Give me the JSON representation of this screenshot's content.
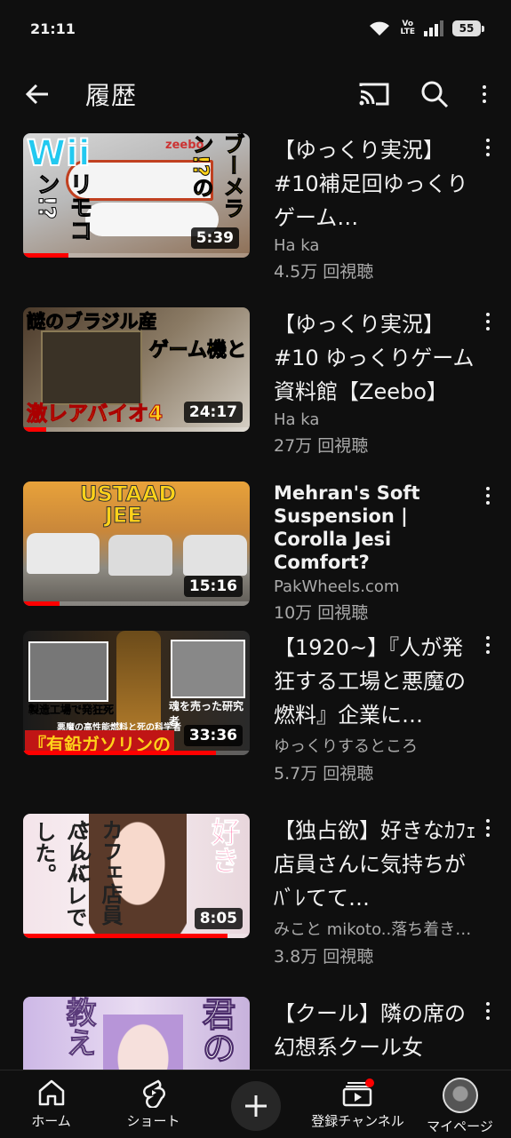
{
  "status": {
    "time": "21:11",
    "battery": "55",
    "volte_top": "Vo",
    "volte_bottom": "LTE"
  },
  "header": {
    "title": "履歴"
  },
  "videos": [
    {
      "title": "【ゆっくり実況】#10補足回ゆっくりゲーム…",
      "channel": "Ha ka",
      "views": "4.5万 回視聴",
      "duration": "5:39",
      "progress": 0.2,
      "thumb_texts": [
        "Wii",
        "リモコン!?",
        "ブーメラン!?の",
        "zeebo"
      ]
    },
    {
      "title": "【ゆっくり実況】#10 ゆっくりゲーム資料館【Zeebo】",
      "channel": "Ha ka",
      "views": "27万 回視聴",
      "duration": "24:17",
      "progress": 0.1,
      "thumb_texts": [
        "謎のブラジル産",
        "ゲーム機と",
        "激レアバイオ4"
      ]
    },
    {
      "title": "Mehran's Soft Suspension | Corolla Jesi Comfort?",
      "channel": "PakWheels.com",
      "views": "10万 回視聴",
      "duration": "15:16",
      "progress": 0.16,
      "thumb_texts": [
        "USTAAD",
        "JEE"
      ]
    },
    {
      "title": "【1920~】『人が発狂する工場と悪魔の燃料』企業に…",
      "channel": "ゆっくりするところ",
      "views": "5.7万 回視聴",
      "duration": "33:36",
      "progress": 0.85,
      "thumb_texts": [
        "製造工場で発狂死",
        "魂を売った研究者",
        "悪魔の高性能燃料と死の科学者",
        "『有鉛ガソリンの"
      ]
    },
    {
      "title": "【独占欲】好きなｶﾌｪ店員さんに気持ちがﾊﾞﾚてて…",
      "channel": "みこと mikoto..落ち着き…",
      "views": "3.8万 回視聴",
      "duration": "8:05",
      "progress": 0.9,
      "thumb_texts": [
        "カフェ店員さんに",
        "バレバレでした。",
        "好き"
      ]
    },
    {
      "title": "【クール】隣の席の幻想系クール女",
      "channel": "",
      "views": "",
      "duration": "",
      "progress": 0,
      "thumb_texts": [
        "教え",
        "君の"
      ]
    }
  ],
  "nav": {
    "home": "ホーム",
    "shorts": "ショート",
    "subscriptions": "登録チャンネル",
    "mypage": "マイページ"
  },
  "colors": {
    "accent": "#ff0000",
    "background": "#0f0f0f",
    "secondary_text": "#aaaaaa"
  }
}
